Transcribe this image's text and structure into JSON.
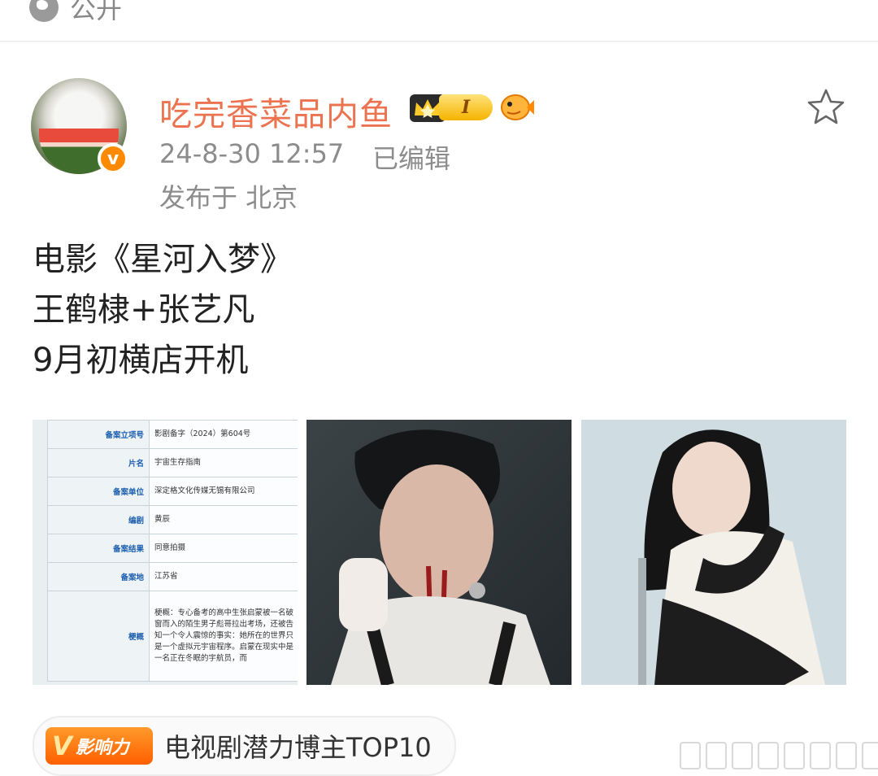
{
  "header": {
    "visibility_label": "公开"
  },
  "post": {
    "author": {
      "name": "吃完香菜品内鱼",
      "level_badge": "I"
    },
    "timestamp": "24-8-30 12:57",
    "edited_label": "已编辑",
    "location": "发布于 北京",
    "text_lines": [
      "电影《星河入梦》",
      "王鹤棣+张艺凡",
      "9月初横店开机"
    ]
  },
  "filing_doc": {
    "rows": [
      {
        "key": "备案立项号",
        "value": "影剧备字（2024）第604号"
      },
      {
        "key": "片名",
        "value": "宇宙生存指南"
      },
      {
        "key": "备案单位",
        "value": "深定格文化传媒无锡有限公司"
      },
      {
        "key": "编剧",
        "value": "黄辰"
      },
      {
        "key": "备案结果",
        "value": "同意拍摄"
      },
      {
        "key": "备案地",
        "value": "江苏省"
      },
      {
        "key": "梗概",
        "value": "梗概：专心备考的高中生张启蒙被一名破窗而入的陌生男子彪哥拉出考场，还被告知一个令人震惊的事实：她所在的世界只是一个虚拟元宇宙程序。启蒙在现实中是一名正在冬眠的宇航员，而"
      }
    ]
  },
  "influence": {
    "badge_label": "影响力",
    "text": "电视剧潜力博主TOP10"
  },
  "colors": {
    "username": "#eb7350",
    "meta": "#8c8c8c",
    "verified": "#ff8a00",
    "influence": "#ff6a00"
  }
}
